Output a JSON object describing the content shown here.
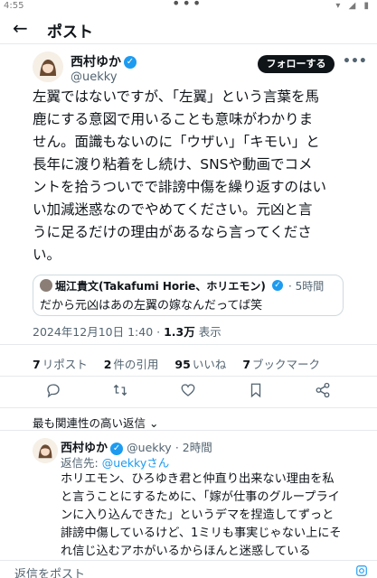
{
  "statusbar": {
    "time": "4:55",
    "dots": "•••",
    "system": "▾ ◢ ▮"
  },
  "header": {
    "title": "ポスト"
  },
  "author": {
    "name": "西村ゆか",
    "handle": "@uekky",
    "follow_label": "フォローする",
    "more_label": "•••"
  },
  "tweet": {
    "text": "左翼ではないですが、「左翼」という言葉を馬\n鹿にする意図で用いることも意味がわかりま\nせん。面識もないのに「ウザい」「キモい」と\n長年に渡り粘着をし続け、SNSや動画でコメ\nントを拾うついでで誹謗中傷を繰り返すのはい\nい加減迷惑なのでやめてください。元凶と言\nうに足るだけの理由があるなら言ってくださ\nい。",
    "quote": {
      "name": "堀江貴文(Takafumi Horie、ホリエモン)",
      "time": "· 5時間",
      "text": "だから元凶はあの左翼の嫁なんだってば笑"
    },
    "datetime": "2024年12月10日 1:40 ·",
    "views_value": "1.3万",
    "views_label": "表示"
  },
  "stats": {
    "reposts_value": "7",
    "reposts_label": "リポスト",
    "quotes_value": "2",
    "quotes_label": "件の引用",
    "likes_value": "95",
    "likes_label": "いいね",
    "bookmarks_value": "7",
    "bookmarks_label": "ブックマーク"
  },
  "actions": [
    "reply-icon",
    "repost-icon",
    "like-icon",
    "bookmark-icon",
    "share-icon"
  ],
  "replies_section": {
    "sort_label": "最も関連性の高い返信 ⌄"
  },
  "reply": {
    "name": "西村ゆか",
    "handle": "@uekky",
    "time": "· 2時間",
    "reply_to_prefix": "返信先:",
    "reply_to_handle": "@uekkyさん",
    "text": "ホリエモン、ひろゆき君と仲直り出来ない理由を私\nと言うことにするために、「嫁が仕事のグループライ\nンに入り込んできた」というデマを捏造してずっと\n誹謗中傷しているけど、1ミリも事実じゃない上にそ\nれ信じ込むアホがいるからほんと迷惑している"
  },
  "reply_bar": {
    "placeholder": "返信をポスト"
  },
  "colors": {
    "accent": "#1d9bf0",
    "text": "#0f1419",
    "muted": "#536471",
    "border": "#cfd9de"
  }
}
